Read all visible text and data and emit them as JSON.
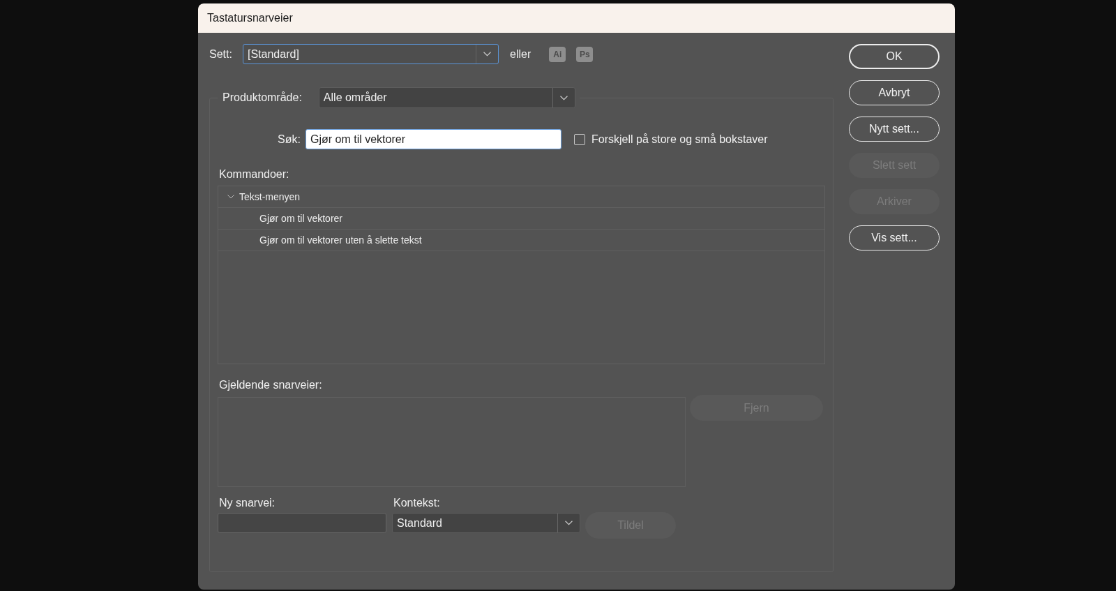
{
  "window": {
    "title": "Tastatursnarveier"
  },
  "set": {
    "label": "Sett:",
    "value": "[Standard]",
    "focused": true,
    "or_label": "eller",
    "app_buttons": [
      {
        "label": "Ai"
      },
      {
        "label": "Ps"
      }
    ]
  },
  "product_area": {
    "label": "Produktområde:",
    "value": "Alle områder"
  },
  "search": {
    "label": "Søk:",
    "value": "Gjør om til vektorer",
    "focused": true,
    "case_sensitive": {
      "label": "Forskjell på store og små bokstaver",
      "checked": false
    }
  },
  "commands": {
    "label": "Kommandoer:",
    "tree": [
      {
        "label": "Tekst-menyen",
        "expanded": true,
        "children": [
          {
            "label": "Gjør om til vektorer"
          },
          {
            "label": "Gjør om til vektorer uten å slette tekst"
          }
        ]
      }
    ]
  },
  "current_shortcuts": {
    "label": "Gjeldende snarveier:",
    "remove_button": {
      "label": "Fjern",
      "disabled": true
    }
  },
  "new_shortcut": {
    "label": "Ny snarvei:"
  },
  "context": {
    "label": "Kontekst:",
    "value": "Standard"
  },
  "assign_button": {
    "label": "Tildel",
    "disabled": true
  },
  "buttons": [
    {
      "label": "OK",
      "default": true,
      "disabled": false
    },
    {
      "label": "Avbryt",
      "default": false,
      "disabled": false
    },
    {
      "label": "Nytt sett...",
      "default": false,
      "disabled": false
    },
    {
      "label": "Slett sett",
      "default": false,
      "disabled": true
    },
    {
      "label": "Arkiver",
      "default": false,
      "disabled": true
    },
    {
      "label": "Vis sett...",
      "default": false,
      "disabled": false
    }
  ]
}
